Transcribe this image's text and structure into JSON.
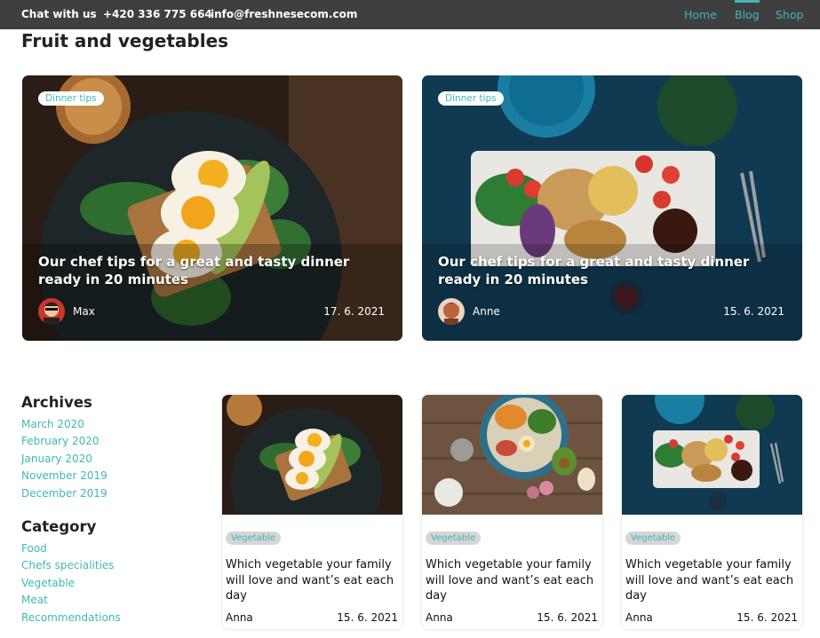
{
  "header": {
    "chat": "Chat with us",
    "phone": "+420 336 775 664",
    "email": "info@freshnesecom.com",
    "nav": [
      "Home",
      "Blog",
      "Shop"
    ],
    "active": "Blog"
  },
  "page_title": "Fruit and vegetables",
  "featured": [
    {
      "tag": "Dinner tips",
      "title": "Our chef tips for a great and tasty dinner ready in 20 minutes",
      "author": "Max",
      "date": "17. 6. 2021"
    },
    {
      "tag": "Dinner tips",
      "title": "Our chef tips for a great and tasty dinner ready in 20 minutes",
      "author": "Anne",
      "date": "15. 6. 2021"
    }
  ],
  "archives": {
    "heading": "Archives",
    "items": [
      "March 2020",
      "February 2020",
      "January 2020",
      "November 2019",
      "December 2019"
    ]
  },
  "category": {
    "heading": "Category",
    "items": [
      "Food",
      "Chefs specialities",
      "Vegetable",
      "Meat",
      "Recommendations"
    ]
  },
  "posts": [
    {
      "tag": "Vegetable",
      "title": "Which vegetable your family will love and want’s eat each day",
      "author": "Anna",
      "date": "15. 6. 2021"
    },
    {
      "tag": "Vegetable",
      "title": "Which vegetable your family will love and want’s eat each day",
      "author": "Anna",
      "date": "15. 6. 2021"
    },
    {
      "tag": "Vegetable",
      "title": "Which vegetable your family will love and want’s eat each day",
      "author": "Anna",
      "date": "15. 6. 2021"
    }
  ],
  "colors": {
    "accent": "#3fb8b5",
    "topbar": "#3f3f3f"
  }
}
